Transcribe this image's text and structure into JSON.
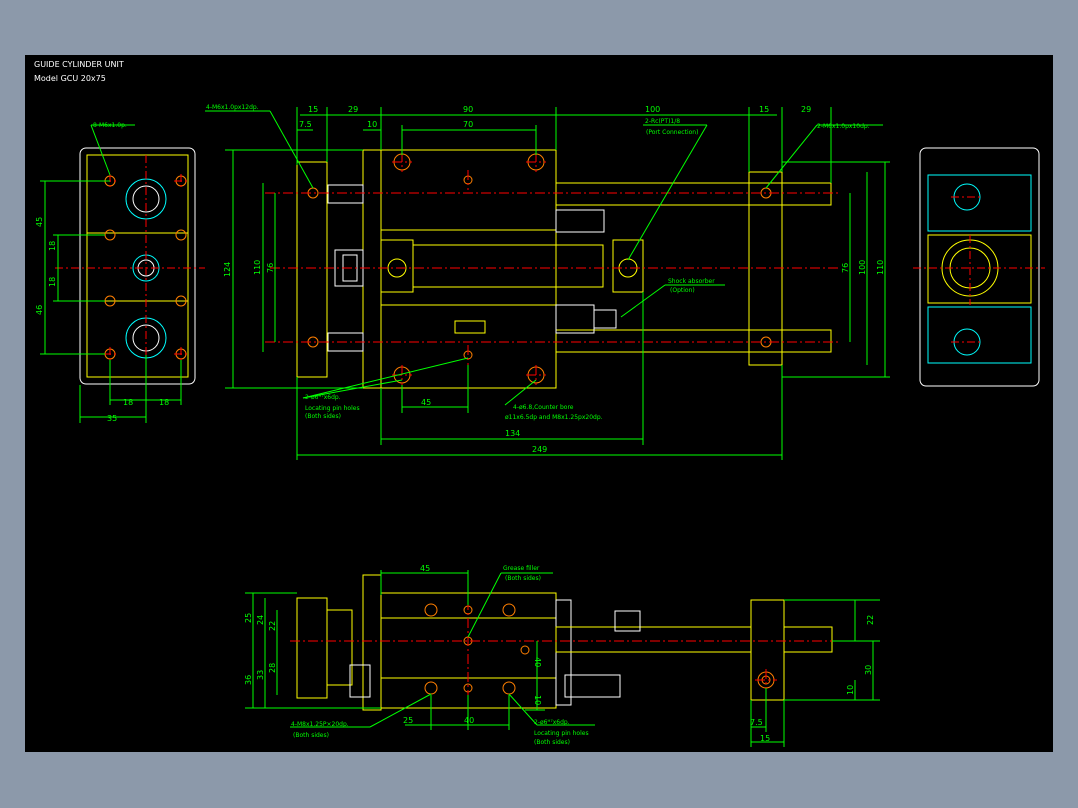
{
  "title": {
    "line1": "GUIDE CYLINDER UNIT",
    "line2": "Model  GCU 20x75"
  },
  "colors": {
    "background": "#000000",
    "outer": "#8c99aa",
    "outline": "#ffff00",
    "dimension": "#00ff00",
    "center": "#ff0000",
    "hidden": "#00ffff",
    "holes": "#ff7f00",
    "white": "#ffffff"
  },
  "front_view": {
    "dims": {
      "d_15_top": "15",
      "d_29_top": "29",
      "d_90": "90",
      "d_100": "100",
      "d_15_right": "15",
      "d_29_right": "29",
      "d_7_5": "7.5",
      "d_10": "10",
      "d_70": "70",
      "d_124": "124",
      "d_110": "110",
      "d_76": "76",
      "d_76_r": "76",
      "d_100_r": "100",
      "d_110_r": "110",
      "d_45": "45",
      "d_134": "134",
      "d_249": "249"
    },
    "notes": {
      "tap_left": "4-M6x1.0px12dp.",
      "port_1": "2-Rc(PT)1/8",
      "port_2": "(Port Connection)",
      "tap_right": "2-M6x1.0px10dp.",
      "shock_1": "Shock absorber",
      "shock_2": "(Option)",
      "pin_1": "2-ø6ᴴ⁷x6dp.",
      "pin_2": "Locating pin holes",
      "pin_3": "(Both sides)",
      "cb_1": "4-ø6.8,Counter bore",
      "cb_2": "ø11x6.5dp and M8x1.25px20dp."
    }
  },
  "left_view": {
    "note": "8-M6x1.0p.",
    "dims": {
      "d_45": "45",
      "d_18a": "18",
      "d_18b": "18",
      "d_46": "46",
      "d_18c": "18",
      "d_18d": "18",
      "d_35": "35"
    }
  },
  "bottom_view": {
    "dims": {
      "d_45": "45",
      "d_25": "25",
      "d_24": "24",
      "d_22": "22",
      "d_36": "36",
      "d_33": "33",
      "d_28": "28",
      "d_40v": "40",
      "d_10v": "10",
      "d_25h": "25",
      "d_40h": "40",
      "d_22r": "22",
      "d_30r": "30",
      "d_10r": "10",
      "d_7_5": "7.5",
      "d_15": "15"
    },
    "notes": {
      "grease_1": "Grease filler",
      "grease_2": "(Both sides)",
      "tap_1": "4-M8x1.25P×20dp.",
      "tap_2": "(Both sides)",
      "pin_1": "2-ø6ᴴ⁷x6dp.",
      "pin_2": "Locating pin holes",
      "pin_3": "(Both sides)"
    }
  }
}
